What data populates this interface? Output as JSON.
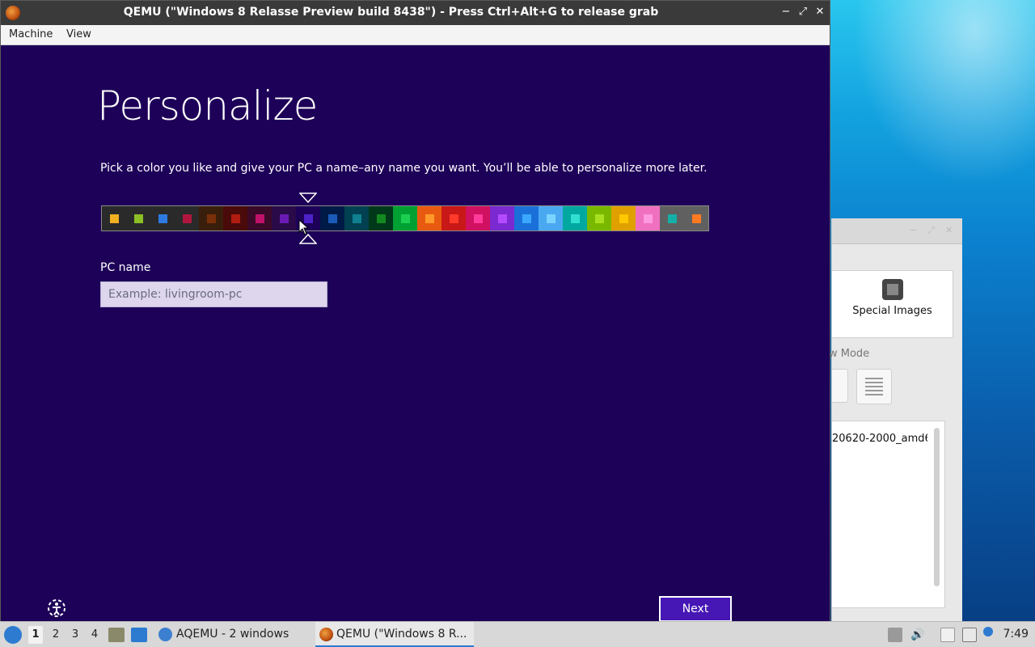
{
  "qemu": {
    "title": "QEMU (\"Windows 8 Relasse Preview build 8438\") - Press Ctrl+Alt+G to release grab",
    "menu": [
      "Machine",
      "View"
    ],
    "minimize_glyph": "−",
    "maximize_glyph": "⤢",
    "close_glyph": "✕"
  },
  "setup": {
    "title": "Personalize",
    "intro": "Pick a color you like and give your PC a name–any name you want. You’ll be able to personalize more later.",
    "pc_name_label": "PC name",
    "pc_name_placeholder": "Example: livingroom-pc",
    "pc_name_value": "",
    "next_label": "Next",
    "selected_color_index": 8,
    "colors": [
      {
        "bg": "#2a2a2a",
        "fg": "#f0b020"
      },
      {
        "bg": "#2a2a2a",
        "fg": "#8cbf26"
      },
      {
        "bg": "#2a2a2a",
        "fg": "#2d7be0"
      },
      {
        "bg": "#2a2a2a",
        "fg": "#b0163d"
      },
      {
        "bg": "#3a1e0c",
        "fg": "#7a3008"
      },
      {
        "bg": "#4a0a0a",
        "fg": "#b01c10"
      },
      {
        "bg": "#3a0a28",
        "fg": "#c0126a"
      },
      {
        "bg": "#2a0a48",
        "fg": "#6a1bb4"
      },
      {
        "bg": "#1d0058",
        "fg": "#4d22c8"
      },
      {
        "bg": "#001a48",
        "fg": "#1a5ab8"
      },
      {
        "bg": "#004050",
        "fg": "#0e8090"
      },
      {
        "bg": "#00381a",
        "fg": "#138a20"
      },
      {
        "bg": "#00a032",
        "fg": "#1bd050"
      },
      {
        "bg": "#e85a10",
        "fg": "#ff9a2a"
      },
      {
        "bg": "#c81818",
        "fg": "#ff3a2a"
      },
      {
        "bg": "#d01060",
        "fg": "#ff3a9a"
      },
      {
        "bg": "#7a2ad0",
        "fg": "#b44aff"
      },
      {
        "bg": "#1a70d8",
        "fg": "#3aa8ff"
      },
      {
        "bg": "#4aa8f0",
        "fg": "#7ad4ff"
      },
      {
        "bg": "#00a8a0",
        "fg": "#30e0d0"
      },
      {
        "bg": "#7ab800",
        "fg": "#a8e020"
      },
      {
        "bg": "#e0a000",
        "fg": "#ffc800"
      },
      {
        "bg": "#f070c0",
        "fg": "#ff9ae0"
      },
      {
        "bg": "#606060",
        "fg": "#14b0a8"
      },
      {
        "bg": "#606060",
        "fg": "#ff7a20"
      }
    ]
  },
  "bg_window": {
    "card_label": "Special Images",
    "view_mode_label": "w Mode",
    "list_item": "20620-2000_amd6"
  },
  "taskbar": {
    "workspaces": [
      "1",
      "2",
      "3",
      "4"
    ],
    "active_workspace": "1",
    "tasks": [
      {
        "label": "AQEMU - 2 windows",
        "active": false
      },
      {
        "label": "QEMU (\"Windows 8 R...",
        "active": true
      }
    ],
    "clock": "7:49"
  }
}
